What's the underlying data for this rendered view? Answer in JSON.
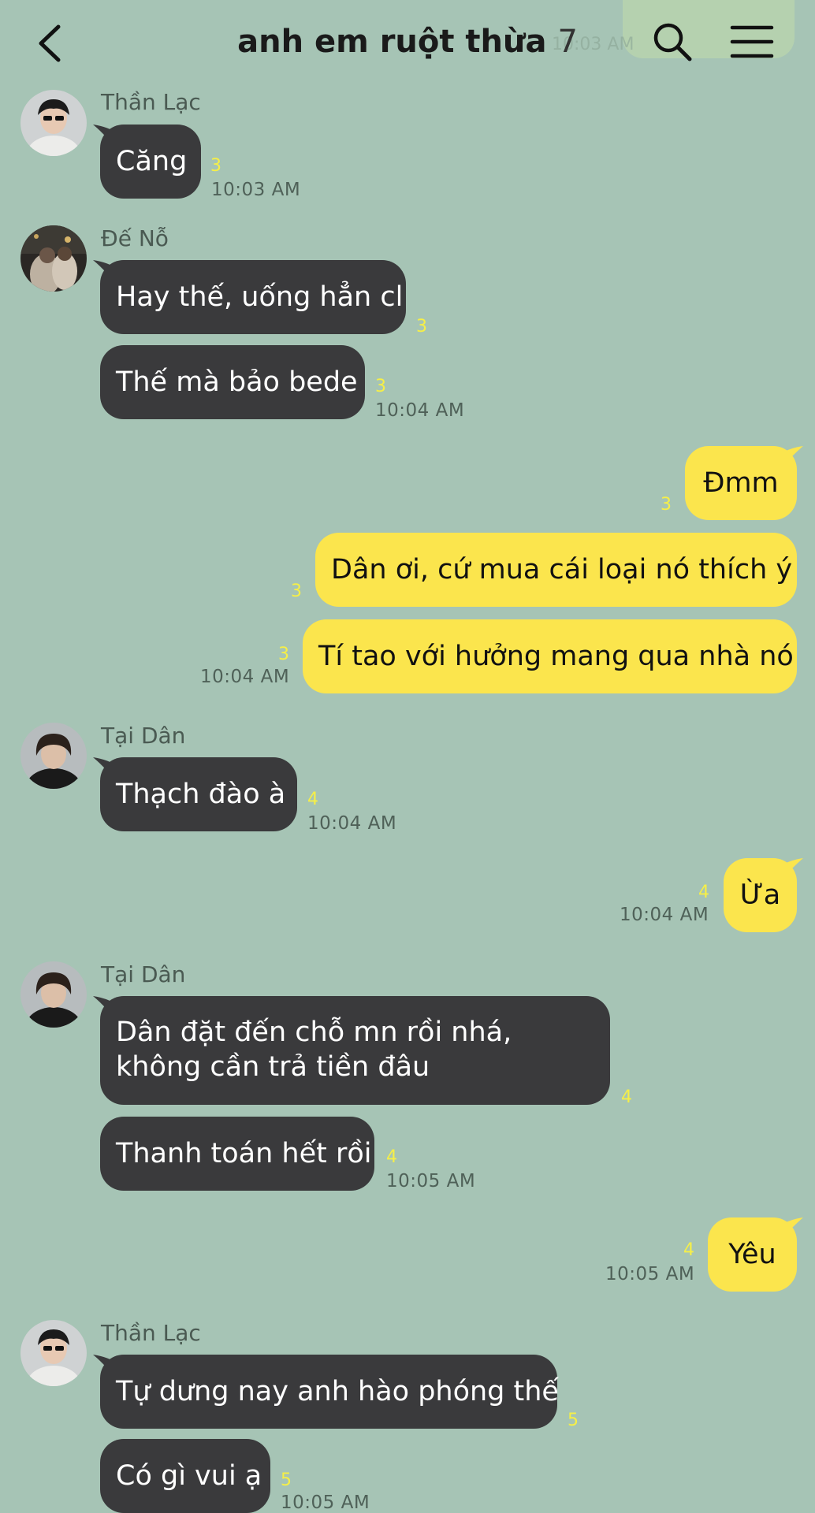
{
  "header": {
    "title": "anh em ruột thừa",
    "member_count": "7",
    "back_icon": "chevron-left-icon",
    "search_icon": "search-icon",
    "menu_icon": "menu-icon",
    "ghost_time": "10:03 AM"
  },
  "colors": {
    "background": "#a6c4b5",
    "incoming": "#3a3a3c",
    "outgoing": "#fbe54d",
    "read_count": "#f6ef47"
  },
  "messages": [
    {
      "sender": "Thần Lạc",
      "text": "Căng",
      "read": "3",
      "time": "10:03 AM"
    },
    {
      "sender": "Đế Nỗ",
      "text": "Hay thế, uống hẳn cl",
      "read": "3"
    },
    {
      "text": "Thế mà bảo bede",
      "read": "3",
      "time": "10:04 AM"
    },
    {
      "text": "Đmm",
      "read": "3"
    },
    {
      "text": "Dân ơi, cứ mua cái loại nó thích ý",
      "read": "3"
    },
    {
      "text": "Tí tao với hưởng mang qua nhà nó",
      "read": "3",
      "time": "10:04 AM"
    },
    {
      "sender": "Tại Dân",
      "text": "Thạch đào à",
      "read": "4",
      "time": "10:04 AM"
    },
    {
      "text": "Ừa",
      "read": "4",
      "time": "10:04 AM"
    },
    {
      "sender": "Tại Dân",
      "text": "Dân đặt đến chỗ mn rồi nhá, không cần trả tiền đâu",
      "read": "4"
    },
    {
      "text": "Thanh toán hết rồi",
      "read": "4",
      "time": "10:05 AM"
    },
    {
      "text": "Yêu",
      "read": "4",
      "time": "10:05 AM"
    },
    {
      "sender": "Thần Lạc",
      "text": "Tự dưng nay anh hào phóng thế",
      "read": "5"
    },
    {
      "text": "Có gì vui ạ",
      "read": "5",
      "time": "10:05 AM"
    }
  ]
}
